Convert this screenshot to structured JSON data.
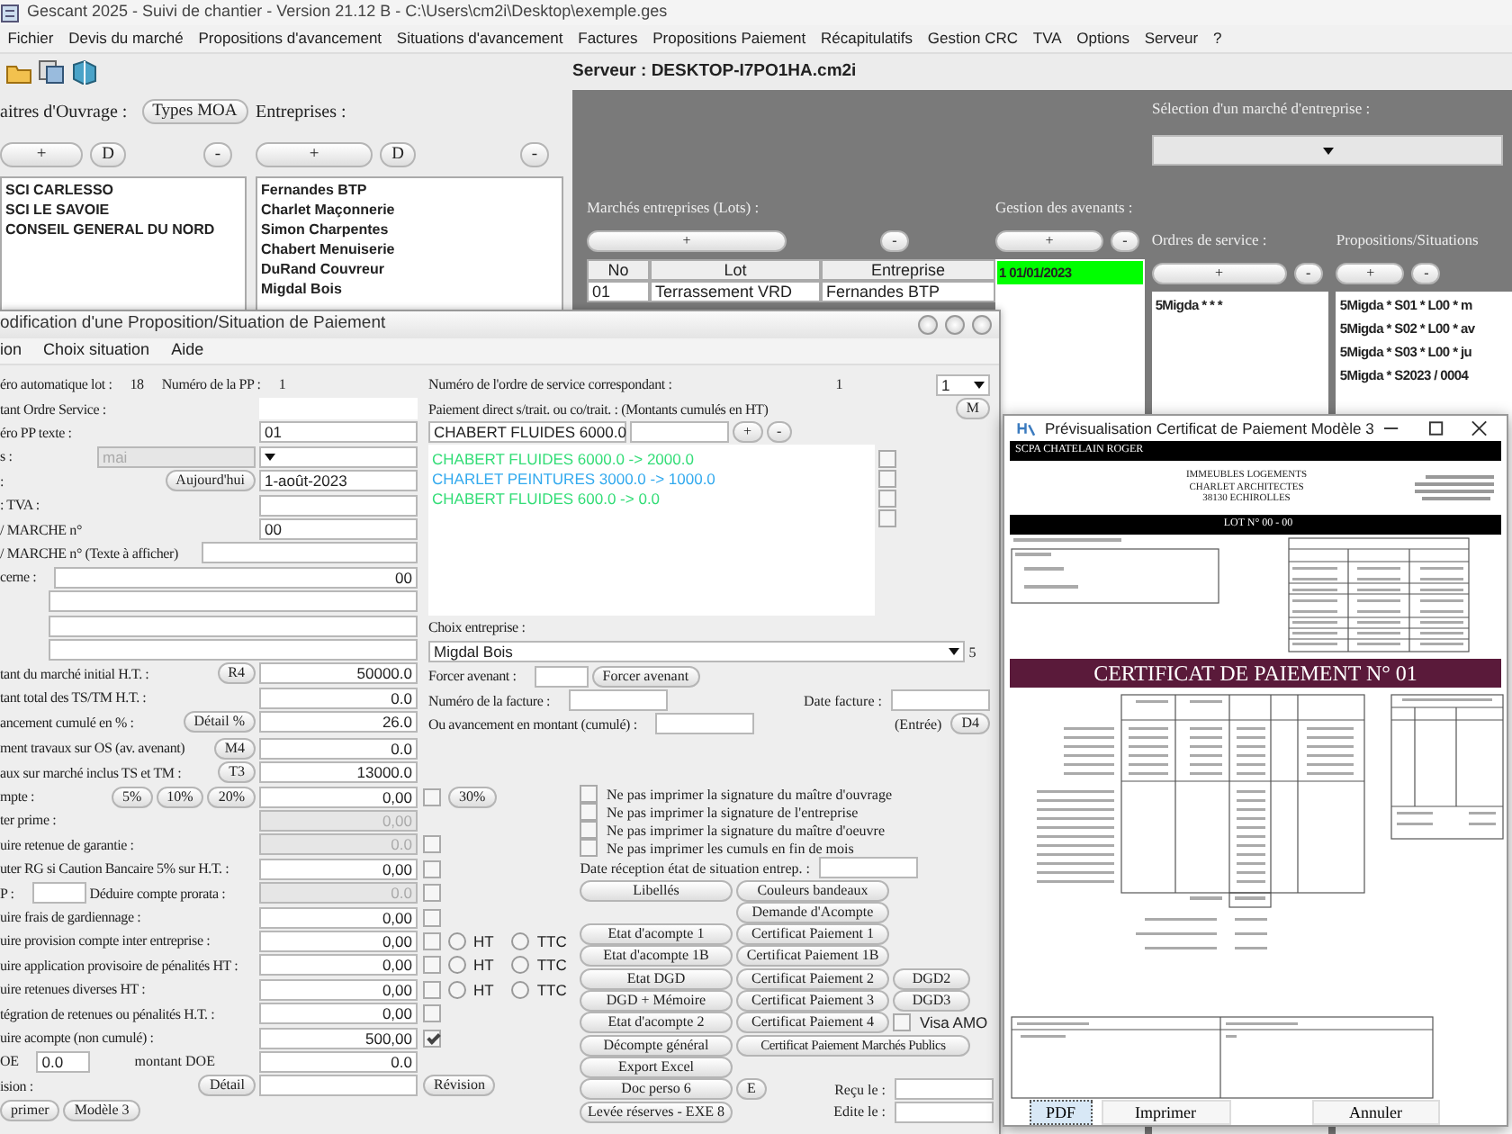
{
  "main": {
    "title": "Gescant 2025 - Suivi de chantier - Version 21.12 B - C:\\Users\\cm2i\\Desktop\\exemple.ges",
    "menu": [
      "Fichier",
      "Devis du marché",
      "Propositions d'avancement",
      "Situations d'avancement",
      "Factures",
      "Propositions Paiement",
      "Récapitulatifs",
      "Gestion CRC",
      "TVA",
      "Options",
      "Serveur",
      "?"
    ],
    "server": "Serveur : DESKTOP-I7PO1HA.cm2i",
    "moa": {
      "label": "aitres d'Ouvrage :",
      "type_button": "Types MOA",
      "buttons": [
        "+",
        "D",
        "-"
      ],
      "items": [
        "SCI CARLESSO",
        "SCI LE SAVOIE",
        "CONSEIL GENERAL DU NORD"
      ]
    },
    "companies": {
      "label": "Entreprises :",
      "buttons": [
        "+",
        "D",
        "-"
      ],
      "items": [
        "Fernandes BTP",
        "Charlet Maçonnerie",
        "Simon Charpentes",
        "Chabert Menuiserie",
        "DuRand Couvreur",
        "Migdal Bois"
      ]
    },
    "panel": {
      "selection_label": "Sélection d'un marché d'entreprise :",
      "lots": {
        "label": "Marchés entreprises (Lots) :",
        "buttons": [
          "+",
          "-"
        ],
        "columns": [
          "No",
          "Lot",
          "Entreprise"
        ],
        "rows": [
          [
            "01",
            "Terrassement VRD",
            "Fernandes BTP"
          ]
        ]
      },
      "avenants": {
        "label": "Gestion des avenants :",
        "buttons": [
          "+",
          "-"
        ],
        "items": [
          {
            "text": "1 01/01/2023",
            "selected": true
          }
        ]
      },
      "orders": {
        "label": "Ordres de service :",
        "buttons": [
          "+",
          "-"
        ],
        "items": [
          {
            "text": "5Migda *  *  *",
            "selected": false
          }
        ]
      },
      "proposals": {
        "label": "Propositions/Situations",
        "buttons": [
          "+",
          "-"
        ],
        "items": [
          {
            "text": "5Migda * S01 * L00 * m",
            "selected": false
          },
          {
            "text": "5Migda * S02 * L00 * av",
            "selected": false
          },
          {
            "text": "5Migda * S03 * L00 * ju",
            "selected": false
          },
          {
            "text": "5Migda * S2023 / 0004",
            "selected": false
          }
        ]
      }
    }
  },
  "form": {
    "title": "odification d'une Proposition/Situation de Paiement",
    "menu": [
      "ion",
      "Choix situation",
      "Aide"
    ],
    "left_top": [
      {
        "parts": [
          {
            "kind": "text",
            "text": "éro automatique lot :"
          },
          {
            "kind": "text",
            "text": "18"
          },
          {
            "kind": "text",
            "text": "Numéro de la PP :"
          },
          {
            "kind": "text",
            "text": "1"
          }
        ]
      },
      {
        "parts": [
          {
            "kind": "label",
            "text": "tant Ordre Service :"
          },
          {
            "kind": "plain"
          }
        ]
      },
      {
        "parts": [
          {
            "kind": "label",
            "text": "éro PP texte :"
          },
          {
            "kind": "field",
            "text": "01"
          }
        ]
      },
      {
        "parts": [
          {
            "kind": "label",
            "text": "s :"
          },
          {
            "kind": "dis",
            "text": "mai"
          },
          {
            "kind": "select"
          }
        ]
      },
      {
        "parts": [
          {
            "kind": "label",
            "text": ":"
          },
          {
            "kind": "btn",
            "text": "Aujourd'hui"
          },
          {
            "kind": "field",
            "text": "1-août-2023"
          }
        ]
      },
      {
        "parts": [
          {
            "kind": "label",
            "text": ": TVA :"
          },
          {
            "kind": "field"
          }
        ]
      },
      {
        "parts": [
          {
            "kind": "label",
            "text": "/ MARCHE n°"
          },
          {
            "kind": "field",
            "text": "00"
          }
        ]
      },
      {
        "parts": [
          {
            "kind": "label",
            "text": "/ MARCHE n° (Texte à afficher)"
          },
          {
            "kind": "lfield"
          }
        ]
      },
      {
        "parts": [
          {
            "kind": "text",
            "text": "cerne :"
          },
          {
            "kind": "wnum",
            "text": "00"
          }
        ]
      },
      {
        "parts": [
          {
            "kind": "indent"
          },
          {
            "kind": "wfield"
          }
        ]
      },
      {
        "parts": [
          {
            "kind": "indent"
          },
          {
            "kind": "wfield"
          }
        ]
      },
      {
        "parts": [
          {
            "kind": "indent"
          },
          {
            "kind": "wfield"
          }
        ]
      },
      {
        "parts": [
          {
            "kind": "label",
            "text": "tant du marché initial H.T. :"
          },
          {
            "kind": "btn",
            "text": "R4"
          },
          {
            "kind": "num",
            "text": "50000.0"
          }
        ]
      },
      {
        "parts": [
          {
            "kind": "label",
            "text": "tant total des TS/TM H.T. :"
          },
          {
            "kind": "num",
            "text": "0.0"
          }
        ]
      },
      {
        "parts": [
          {
            "kind": "label",
            "text": "ancement cumulé en % :"
          },
          {
            "kind": "btn",
            "text": "Détail %"
          },
          {
            "kind": "num",
            "text": "26.0"
          }
        ]
      }
    ],
    "right_top_a": [
      {
        "parts": [
          {
            "kind": "label",
            "text": "Numéro de l'ordre de service correspondant :"
          },
          {
            "kind": "text",
            "text": "1"
          },
          {
            "kind": "spacer"
          },
          {
            "kind": "nselect",
            "text": "1"
          }
        ]
      },
      {
        "parts": [
          {
            "kind": "label",
            "text": "Paiement direct s/trait. ou co/trait. : (Montants cumulés en HT)"
          },
          {
            "kind": "btn",
            "text": "M"
          }
        ]
      },
      {
        "parts": [
          {
            "kind": "mselect",
            "text": "CHABERT FLUIDES 6000.0"
          },
          {
            "kind": "mfield"
          },
          {
            "kind": "btn",
            "text": "+"
          },
          {
            "kind": "btn",
            "text": "-"
          }
        ]
      }
    ],
    "payments": [
      {
        "text": "CHABERT FLUIDES 6000.0 -> 2000.0",
        "color": "#33dd77"
      },
      {
        "text": "CHARLET PEINTURES 3000.0 -> 1000.0",
        "color": "#33aaee"
      },
      {
        "text": "CHABERT FLUIDES 600.0 -> 0.0",
        "color": "#33dd77"
      }
    ],
    "payment_checks": [
      false,
      false,
      false,
      false
    ],
    "right_top_b": [
      {
        "parts": [
          {
            "kind": "label",
            "text": "Choix entreprise :"
          }
        ]
      },
      {
        "parts": [
          {
            "kind": "wselect",
            "text": "Migdal Bois"
          },
          {
            "kind": "text",
            "text": "5"
          }
        ]
      },
      {
        "parts": [
          {
            "kind": "text",
            "text": "Forcer avenant :"
          },
          {
            "kind": "small"
          },
          {
            "kind": "btn",
            "text": "Forcer avenant"
          }
        ]
      },
      {
        "parts": [
          {
            "kind": "text",
            "text": "Numéro de la facture :"
          },
          {
            "kind": "mfield"
          },
          {
            "kind": "rlabel",
            "text": "Date facture :"
          },
          {
            "kind": "mfield"
          }
        ]
      },
      {
        "parts": [
          {
            "kind": "text",
            "text": "Ou avancement en montant (cumulé) :"
          },
          {
            "kind": "mfield"
          },
          {
            "kind": "rlabel",
            "text": "(Entrée)"
          },
          {
            "kind": "btn",
            "text": "D4"
          }
        ]
      }
    ],
    "left_bottom": [
      {
        "parts": [
          {
            "kind": "label",
            "text": "ment travaux sur OS (av. avenant)"
          },
          {
            "kind": "btn",
            "text": "M4"
          },
          {
            "kind": "num",
            "text": "0.0"
          }
        ]
      },
      {
        "parts": [
          {
            "kind": "label",
            "text": "aux sur marché inclus TS et TM :"
          },
          {
            "kind": "btn",
            "text": "T3"
          },
          {
            "kind": "num",
            "text": "13000.0"
          }
        ]
      },
      {
        "parts": [
          {
            "kind": "label",
            "text": "mpte :"
          },
          {
            "kind": "btn",
            "text": "5%"
          },
          {
            "kind": "btn",
            "text": "10%"
          },
          {
            "kind": "btn",
            "text": "20%"
          },
          {
            "kind": "num",
            "text": "0,00"
          }
        ],
        "after": [
          {
            "kind": "check",
            "checked": false
          },
          {
            "kind": "btn",
            "text": "30%"
          }
        ]
      },
      {
        "parts": [
          {
            "kind": "label",
            "text": "ter prime :"
          },
          {
            "kind": "dnum",
            "text": "0,00"
          }
        ]
      },
      {
        "parts": [
          {
            "kind": "label",
            "text": "uire retenue de garantie :"
          },
          {
            "kind": "dnum",
            "text": "0.0"
          }
        ],
        "after": [
          {
            "kind": "check",
            "checked": false
          }
        ]
      },
      {
        "parts": [
          {
            "kind": "label",
            "text": "uter RG si Caution Bancaire 5% sur H.T. :"
          },
          {
            "kind": "num",
            "text": "0,00"
          }
        ],
        "after": [
          {
            "kind": "check",
            "checked": false
          }
        ]
      },
      {
        "parts": [
          {
            "kind": "text",
            "text": "P :"
          },
          {
            "kind": "small"
          },
          {
            "kind": "label",
            "text": "Déduire compte prorata :"
          },
          {
            "kind": "dnum",
            "text": "0.0"
          }
        ],
        "after": [
          {
            "kind": "check",
            "checked": false
          }
        ]
      },
      {
        "parts": [
          {
            "kind": "label",
            "text": "uire frais de gardiennage :"
          },
          {
            "kind": "num",
            "text": "0,00"
          }
        ],
        "after": [
          {
            "kind": "check",
            "checked": false
          }
        ]
      },
      {
        "parts": [
          {
            "kind": "label",
            "text": "uire provision compte inter entreprise :"
          },
          {
            "kind": "num",
            "text": "0,00"
          }
        ],
        "after": [
          {
            "kind": "check",
            "checked": false
          },
          {
            "kind": "radio",
            "text": "HT",
            "selected": false
          },
          {
            "kind": "radio",
            "text": "TTC",
            "selected": false
          }
        ]
      },
      {
        "parts": [
          {
            "kind": "label",
            "text": "uire application provisoire de pénalités HT :"
          },
          {
            "kind": "num",
            "text": "0,00"
          }
        ],
        "after": [
          {
            "kind": "check",
            "checked": false
          },
          {
            "kind": "radio",
            "text": "HT",
            "selected": false
          },
          {
            "kind": "radio",
            "text": "TTC",
            "selected": false
          }
        ]
      },
      {
        "parts": [
          {
            "kind": "label",
            "text": "uire retenues diverses HT :"
          },
          {
            "kind": "num",
            "text": "0,00"
          }
        ],
        "after": [
          {
            "kind": "check",
            "checked": false
          },
          {
            "kind": "radio",
            "text": "HT",
            "selected": false
          },
          {
            "kind": "radio",
            "text": "TTC",
            "selected": false
          }
        ]
      },
      {
        "parts": [
          {
            "kind": "label",
            "text": "tégration de retenues ou pénalités H.T. :"
          },
          {
            "kind": "num",
            "text": "0,00"
          }
        ],
        "after": [
          {
            "kind": "check",
            "checked": false
          }
        ]
      },
      {
        "parts": [
          {
            "kind": "label",
            "text": "uire acompte  (non cumulé) :"
          },
          {
            "kind": "num",
            "text": "500,00"
          }
        ],
        "after": [
          {
            "kind": "check",
            "checked": true
          }
        ]
      },
      {
        "parts": [
          {
            "kind": "text",
            "text": "OE"
          },
          {
            "kind": "small",
            "text": "0.0"
          },
          {
            "kind": "clabel",
            "text": "montant DOE"
          },
          {
            "kind": "num",
            "text": "0.0"
          }
        ]
      },
      {
        "parts": [
          {
            "kind": "label",
            "text": "ision :"
          },
          {
            "kind": "btn",
            "text": "Détail"
          },
          {
            "kind": "field"
          }
        ],
        "after": [
          {
            "kind": "btn",
            "text": "Révision"
          }
        ]
      },
      {
        "parts": [
          {
            "kind": "btn",
            "text": "primer"
          },
          {
            "kind": "btn",
            "text": "Modèle 3"
          }
        ]
      }
    ],
    "right_bottom_checks": [
      {
        "text": "Ne pas imprimer la signature du maître d'ouvrage",
        "checked": false
      },
      {
        "text": "Ne pas imprimer la signature de l'entreprise",
        "checked": false
      },
      {
        "text": "Ne pas imprimer la signature du maître d'oeuvre",
        "checked": false
      },
      {
        "text": "Ne pas imprimer les cumuls en fin de mois",
        "checked": false
      }
    ],
    "right_bottom": [
      {
        "parts": [
          {
            "kind": "rlabel",
            "text": "Date réception état de situation entrep. :"
          },
          {
            "kind": "mfield"
          },
          {
            "kind": "spacer"
          }
        ]
      },
      {
        "parts": [
          {
            "kind": "bbtn",
            "text": "Libellés"
          },
          {
            "kind": "bbtn",
            "text": "Couleurs bandeaux"
          }
        ]
      },
      {
        "parts": [
          {
            "kind": "blank"
          },
          {
            "kind": "bbtn",
            "text": "Demande d'Acompte"
          }
        ]
      },
      {
        "parts": [
          {
            "kind": "bbtn",
            "text": "Etat d'acompte 1"
          },
          {
            "kind": "bbtn",
            "text": "Certificat Paiement 1"
          }
        ]
      },
      {
        "parts": [
          {
            "kind": "bbtn",
            "text": "Etat d'acompte 1B"
          },
          {
            "kind": "bbtn",
            "text": "Certificat Paiement 1B"
          }
        ]
      },
      {
        "parts": [
          {
            "kind": "bbtn",
            "text": "Etat DGD"
          },
          {
            "kind": "bbtn",
            "text": "Certificat Paiement 2"
          },
          {
            "kind": "sbtn",
            "text": "DGD2"
          }
        ]
      },
      {
        "parts": [
          {
            "kind": "bbtn",
            "text": "DGD + Mémoire"
          },
          {
            "kind": "bbtn",
            "text": "Certificat Paiement 3"
          },
          {
            "kind": "sbtn",
            "text": "DGD3"
          }
        ]
      },
      {
        "parts": [
          {
            "kind": "bbtn",
            "text": "Etat d'acompte 2"
          },
          {
            "kind": "bbtn",
            "text": "Certificat Paiement 4"
          },
          {
            "kind": "check",
            "text": "Visa AMO",
            "checked": false
          }
        ]
      },
      {
        "parts": [
          {
            "kind": "bbtn",
            "text": "Décompte général"
          },
          {
            "kind": "cbtn",
            "text": "Certificat Paiement Marchés Publics"
          }
        ]
      },
      {
        "parts": [
          {
            "kind": "bbtn",
            "text": "Export Excel"
          }
        ]
      },
      {
        "parts": [
          {
            "kind": "bbtn",
            "text": "Doc perso 6"
          },
          {
            "kind": "btn",
            "text": "E"
          },
          {
            "kind": "rlabel",
            "text": "Reçu le  :"
          },
          {
            "kind": "mfield"
          }
        ]
      },
      {
        "parts": [
          {
            "kind": "bbtn",
            "text": "Levée réserves - EXE 8"
          },
          {
            "kind": "rlabel",
            "text": "Edite le  :"
          },
          {
            "kind": "mfield"
          }
        ]
      }
    ]
  },
  "preview": {
    "title": "Prévisualisation Certificat de Paiement Modèle 3",
    "header": "SCPA CHATELAIN ROGER",
    "address": [
      "IMMEUBLES LOGEMENTS",
      "CHARLET ARCHITECTES",
      "38130 ECHIROLLES"
    ],
    "lot": "LOT N° 00 - 00",
    "certificate": "CERTIFICAT DE PAIEMENT N° 01",
    "buttons": [
      {
        "text": "PDF",
        "selected": true
      },
      {
        "text": "Imprimer",
        "selected": false
      },
      {
        "text": "Annuler",
        "selected": false
      }
    ]
  }
}
